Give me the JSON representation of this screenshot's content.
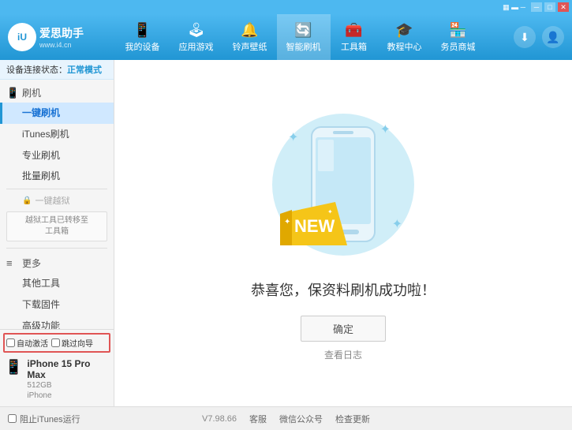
{
  "app": {
    "logo_text": "爱思助手",
    "logo_sub": "www.i4.cn",
    "logo_char": "iⓤ"
  },
  "nav": {
    "tabs": [
      {
        "id": "my-device",
        "icon": "📱",
        "label": "我的设备"
      },
      {
        "id": "apps-games",
        "icon": "👤",
        "label": "应用游戏"
      },
      {
        "id": "ringtones",
        "icon": "🔔",
        "label": "铃声壁纸"
      },
      {
        "id": "smart-flash",
        "icon": "🔄",
        "label": "智能刷机",
        "active": true
      },
      {
        "id": "tools",
        "icon": "🧰",
        "label": "工具箱"
      },
      {
        "id": "tutorials",
        "icon": "🎓",
        "label": "教程中心"
      },
      {
        "id": "store",
        "icon": "🏪",
        "label": "务员商城"
      }
    ],
    "download_icon": "⬇",
    "user_icon": "👤"
  },
  "window_controls": {
    "minimize": "─",
    "maximize": "□",
    "close": "✕"
  },
  "status": {
    "label": "设备连接状态：",
    "mode": "正常模式"
  },
  "sidebar": {
    "section_flash": {
      "icon": "📱",
      "label": "刷机"
    },
    "items": [
      {
        "id": "one-key-flash",
        "label": "一键刷机",
        "active": true
      },
      {
        "id": "itunes-flash",
        "label": "iTunes刷机"
      },
      {
        "id": "pro-flash",
        "label": "专业刷机"
      },
      {
        "id": "batch-flash",
        "label": "批量刷机"
      }
    ],
    "disabled_item": {
      "icon": "🔒",
      "label": "一键越狱"
    },
    "disabled_box_text": "越狱工具已转移至\n工具箱",
    "section_more": {
      "icon": "≡",
      "label": "更多"
    },
    "more_items": [
      {
        "id": "other-tools",
        "label": "其他工具"
      },
      {
        "id": "download-firmware",
        "label": "下载固件"
      },
      {
        "id": "advanced",
        "label": "高级功能"
      }
    ]
  },
  "device": {
    "auto_activate": "自动激活",
    "guide_import": "跳过向导",
    "icon": "📱",
    "name": "iPhone 15 Pro Max",
    "storage": "512GB",
    "type": "iPhone"
  },
  "footer": {
    "block_itunes": "阻止iTunes运行",
    "version": "V7.98.66",
    "links": [
      "客服",
      "微信公众号",
      "检查更新"
    ]
  },
  "content": {
    "success_text": "恭喜您，保资料刷机成功啦！",
    "confirm_btn": "确定",
    "log_link": "查看日志"
  }
}
